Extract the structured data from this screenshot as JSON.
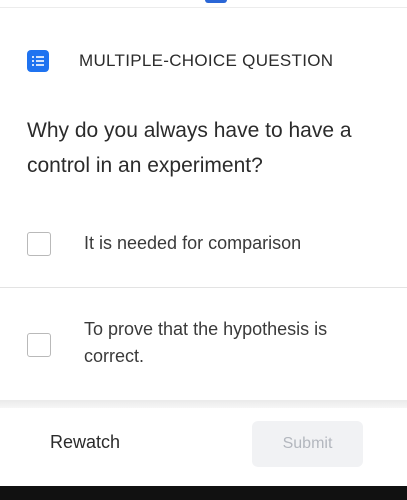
{
  "header": {
    "question_type": "MULTIPLE-CHOICE QUESTION",
    "icon": "list-icon",
    "accent_color": "#1f73f0"
  },
  "question": {
    "text": "Why do you always have to have a control in an experiment?"
  },
  "options": [
    {
      "label": "It is needed for comparison",
      "checked": false
    },
    {
      "label": "To prove that the hypothesis is correct.",
      "checked": false
    }
  ],
  "footer": {
    "rewatch_label": "Rewatch",
    "submit_label": "Submit",
    "submit_enabled": false
  }
}
